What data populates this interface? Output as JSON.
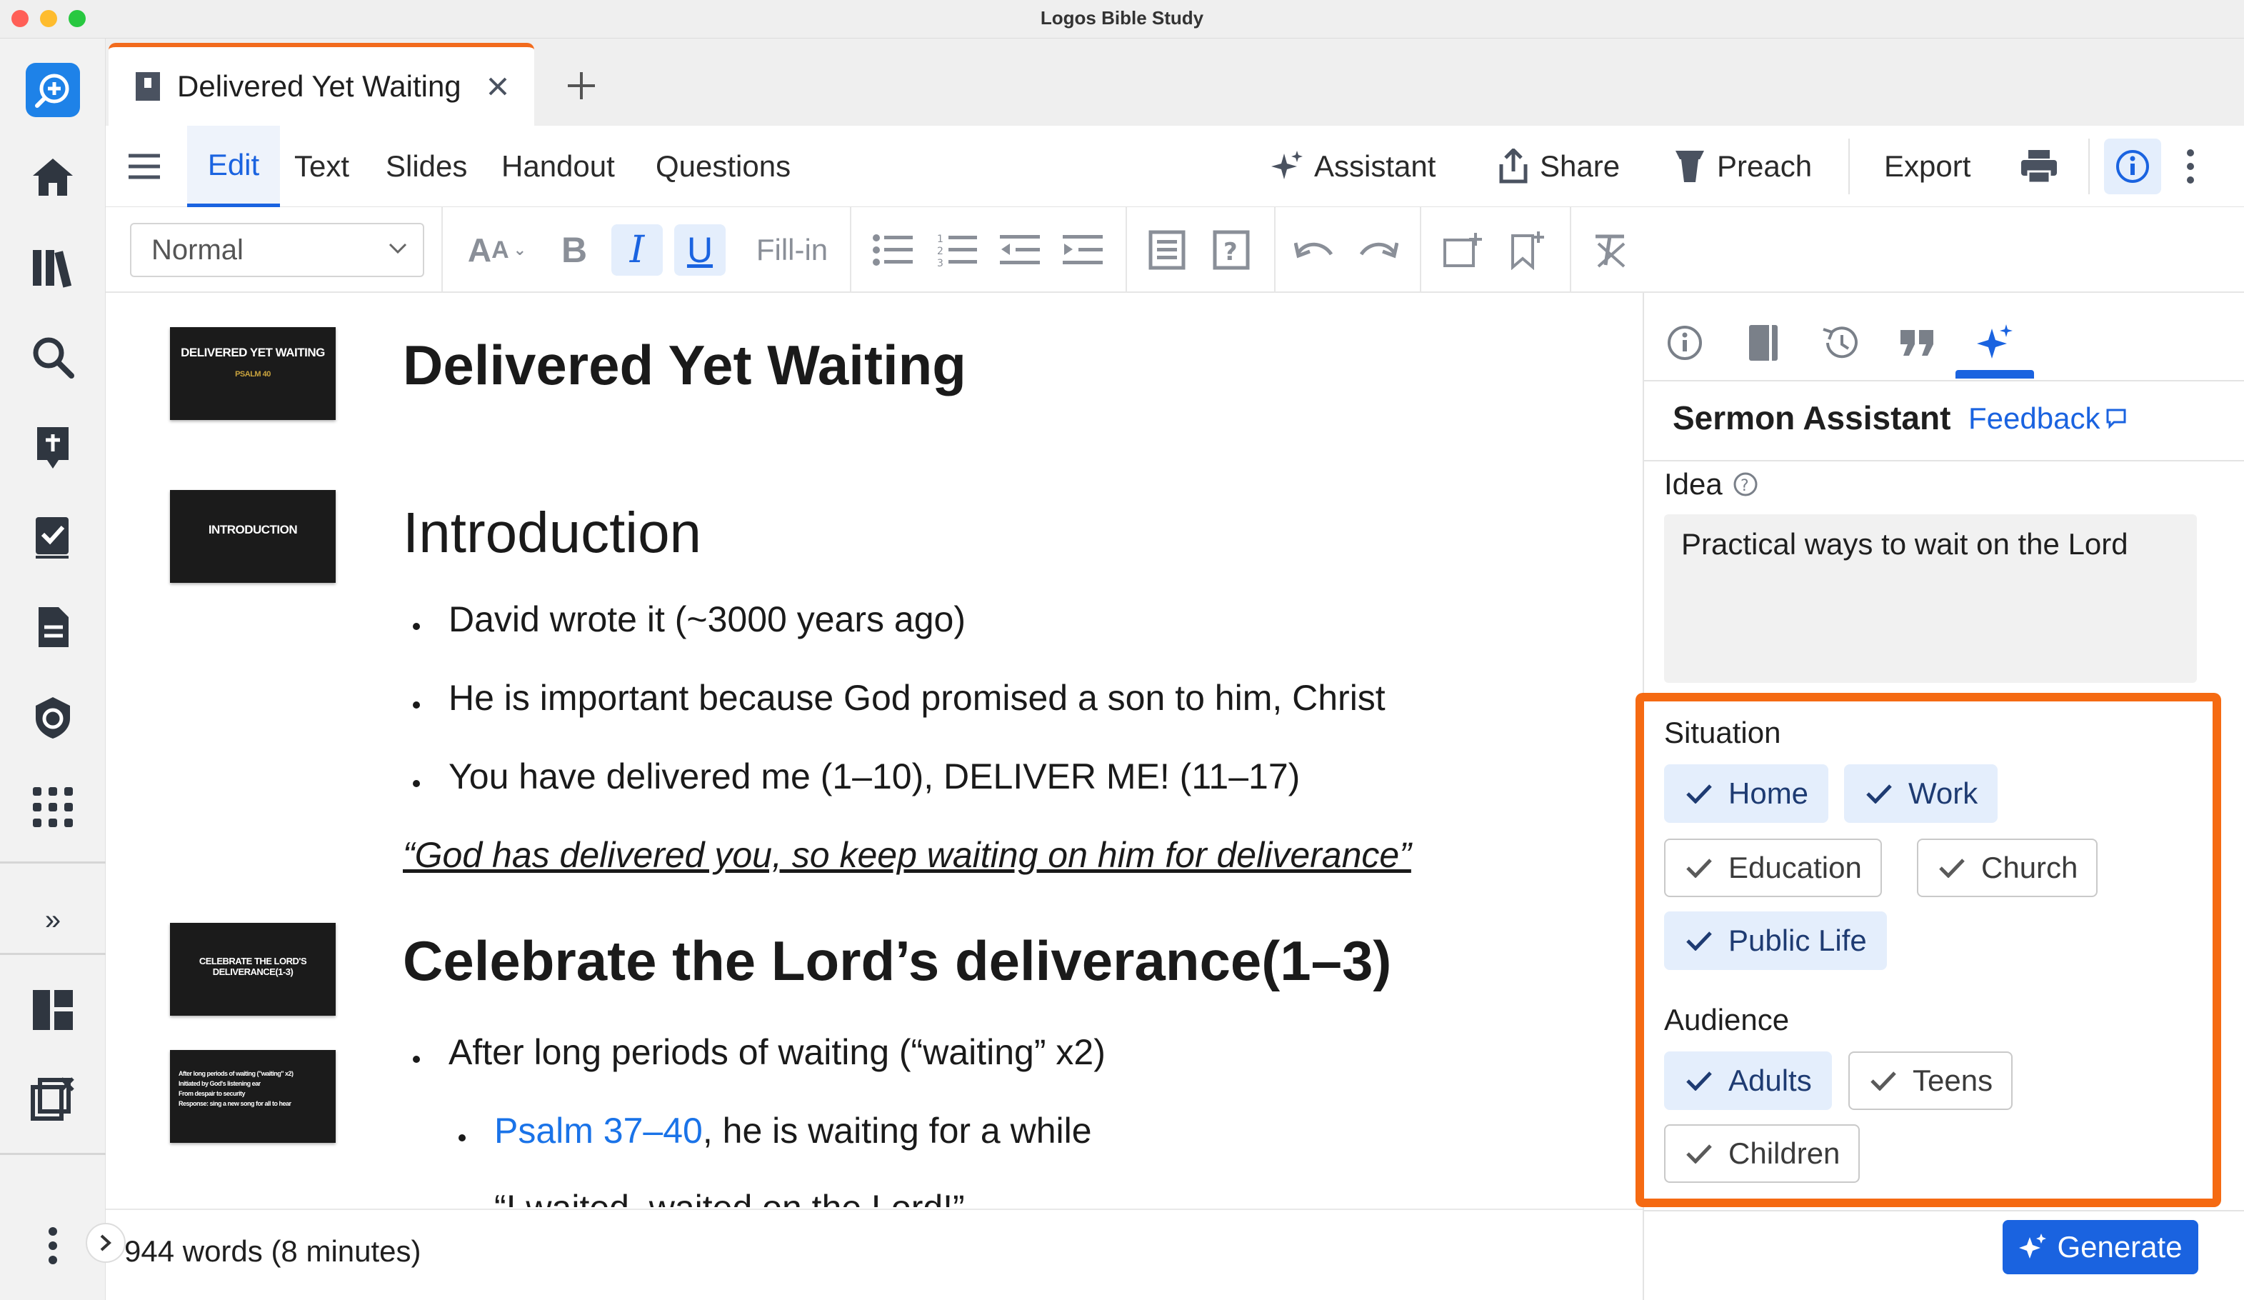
{
  "app": {
    "title": "Logos Bible Study"
  },
  "tab": {
    "title": "Delivered Yet Waiting"
  },
  "menu": {
    "edit": "Edit",
    "text": "Text",
    "slides": "Slides",
    "handout": "Handout",
    "questions": "Questions"
  },
  "actions": {
    "assistant": "Assistant",
    "share": "Share",
    "preach": "Preach",
    "export": "Export"
  },
  "format": {
    "style": "Normal",
    "fill_in": "Fill-in"
  },
  "slides": [
    {
      "title": "DELIVERED YET WAITING",
      "sub": "PSALM 40"
    },
    {
      "title": "INTRODUCTION"
    },
    {
      "title": "CELEBRATE THE LORD'S DELIVERANCE(1-3)"
    },
    {
      "lines": [
        "After long periods of waiting (\"waiting\" x2)",
        "Initiated by God's listening ear",
        "From despair to security",
        "Response: sing a new song for all to hear"
      ]
    }
  ],
  "document": {
    "title": "Delivered Yet Waiting",
    "intro_heading": "Introduction",
    "intro_bullets": [
      "David wrote it (~3000 years ago)",
      "He is important because God promised a son to him, Christ",
      "You have delivered me (1–10), DELIVER ME! (11–17)"
    ],
    "quote": "“God has delivered you, so keep waiting on him for deliverance”",
    "section_heading": "Celebrate the Lord’s deliverance(1–3)",
    "section_bullet": "After long periods of waiting (“waiting” x2)",
    "sub_link": "Psalm 37–40",
    "sub_text": ", he is waiting for a while",
    "cutoff_text": "“I waited, waited on the Lord!”"
  },
  "status": {
    "word_count": "944 words (8 minutes)"
  },
  "assistant": {
    "title": "Sermon Assistant",
    "feedback": "Feedback",
    "idea_label": "Idea",
    "idea_value": "Practical ways to wait on the Lord",
    "situation_label": "Situation",
    "situations": [
      {
        "label": "Home",
        "selected": true
      },
      {
        "label": "Work",
        "selected": true
      },
      {
        "label": "Education",
        "selected": false
      },
      {
        "label": "Church",
        "selected": false
      },
      {
        "label": "Public Life",
        "selected": true
      }
    ],
    "audience_label": "Audience",
    "audiences": [
      {
        "label": "Adults",
        "selected": true
      },
      {
        "label": "Teens",
        "selected": false
      },
      {
        "label": "Children",
        "selected": false
      }
    ],
    "generate": "Generate"
  },
  "colors": {
    "accent": "#1a63e0",
    "highlight": "#f56a12",
    "tab_accent": "#f26b1d"
  }
}
